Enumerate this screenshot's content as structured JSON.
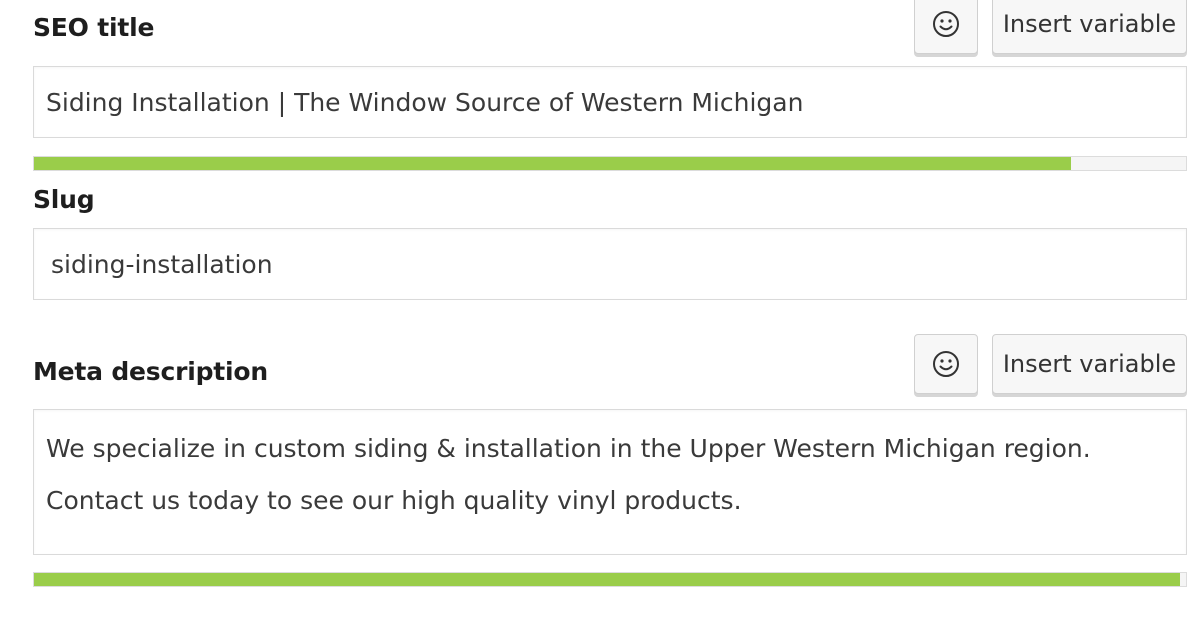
{
  "seo_title": {
    "label": "SEO title",
    "value": "Siding Installation | The Window Source of Western Michigan",
    "progress_fraction": 0.9,
    "progress_color": "#9acd4a"
  },
  "slug": {
    "label": "Slug",
    "value": "siding-installation"
  },
  "meta_description": {
    "label": "Meta description",
    "lines": [
      "We specialize in custom siding & installation in the Upper Western Michigan region.",
      "Contact us today to see our high quality vinyl products."
    ],
    "progress_fraction": 0.995,
    "progress_color": "#9acd4a"
  },
  "buttons": {
    "emoji_icon": "smiley-face-icon",
    "insert_variable_label": "Insert variable"
  }
}
